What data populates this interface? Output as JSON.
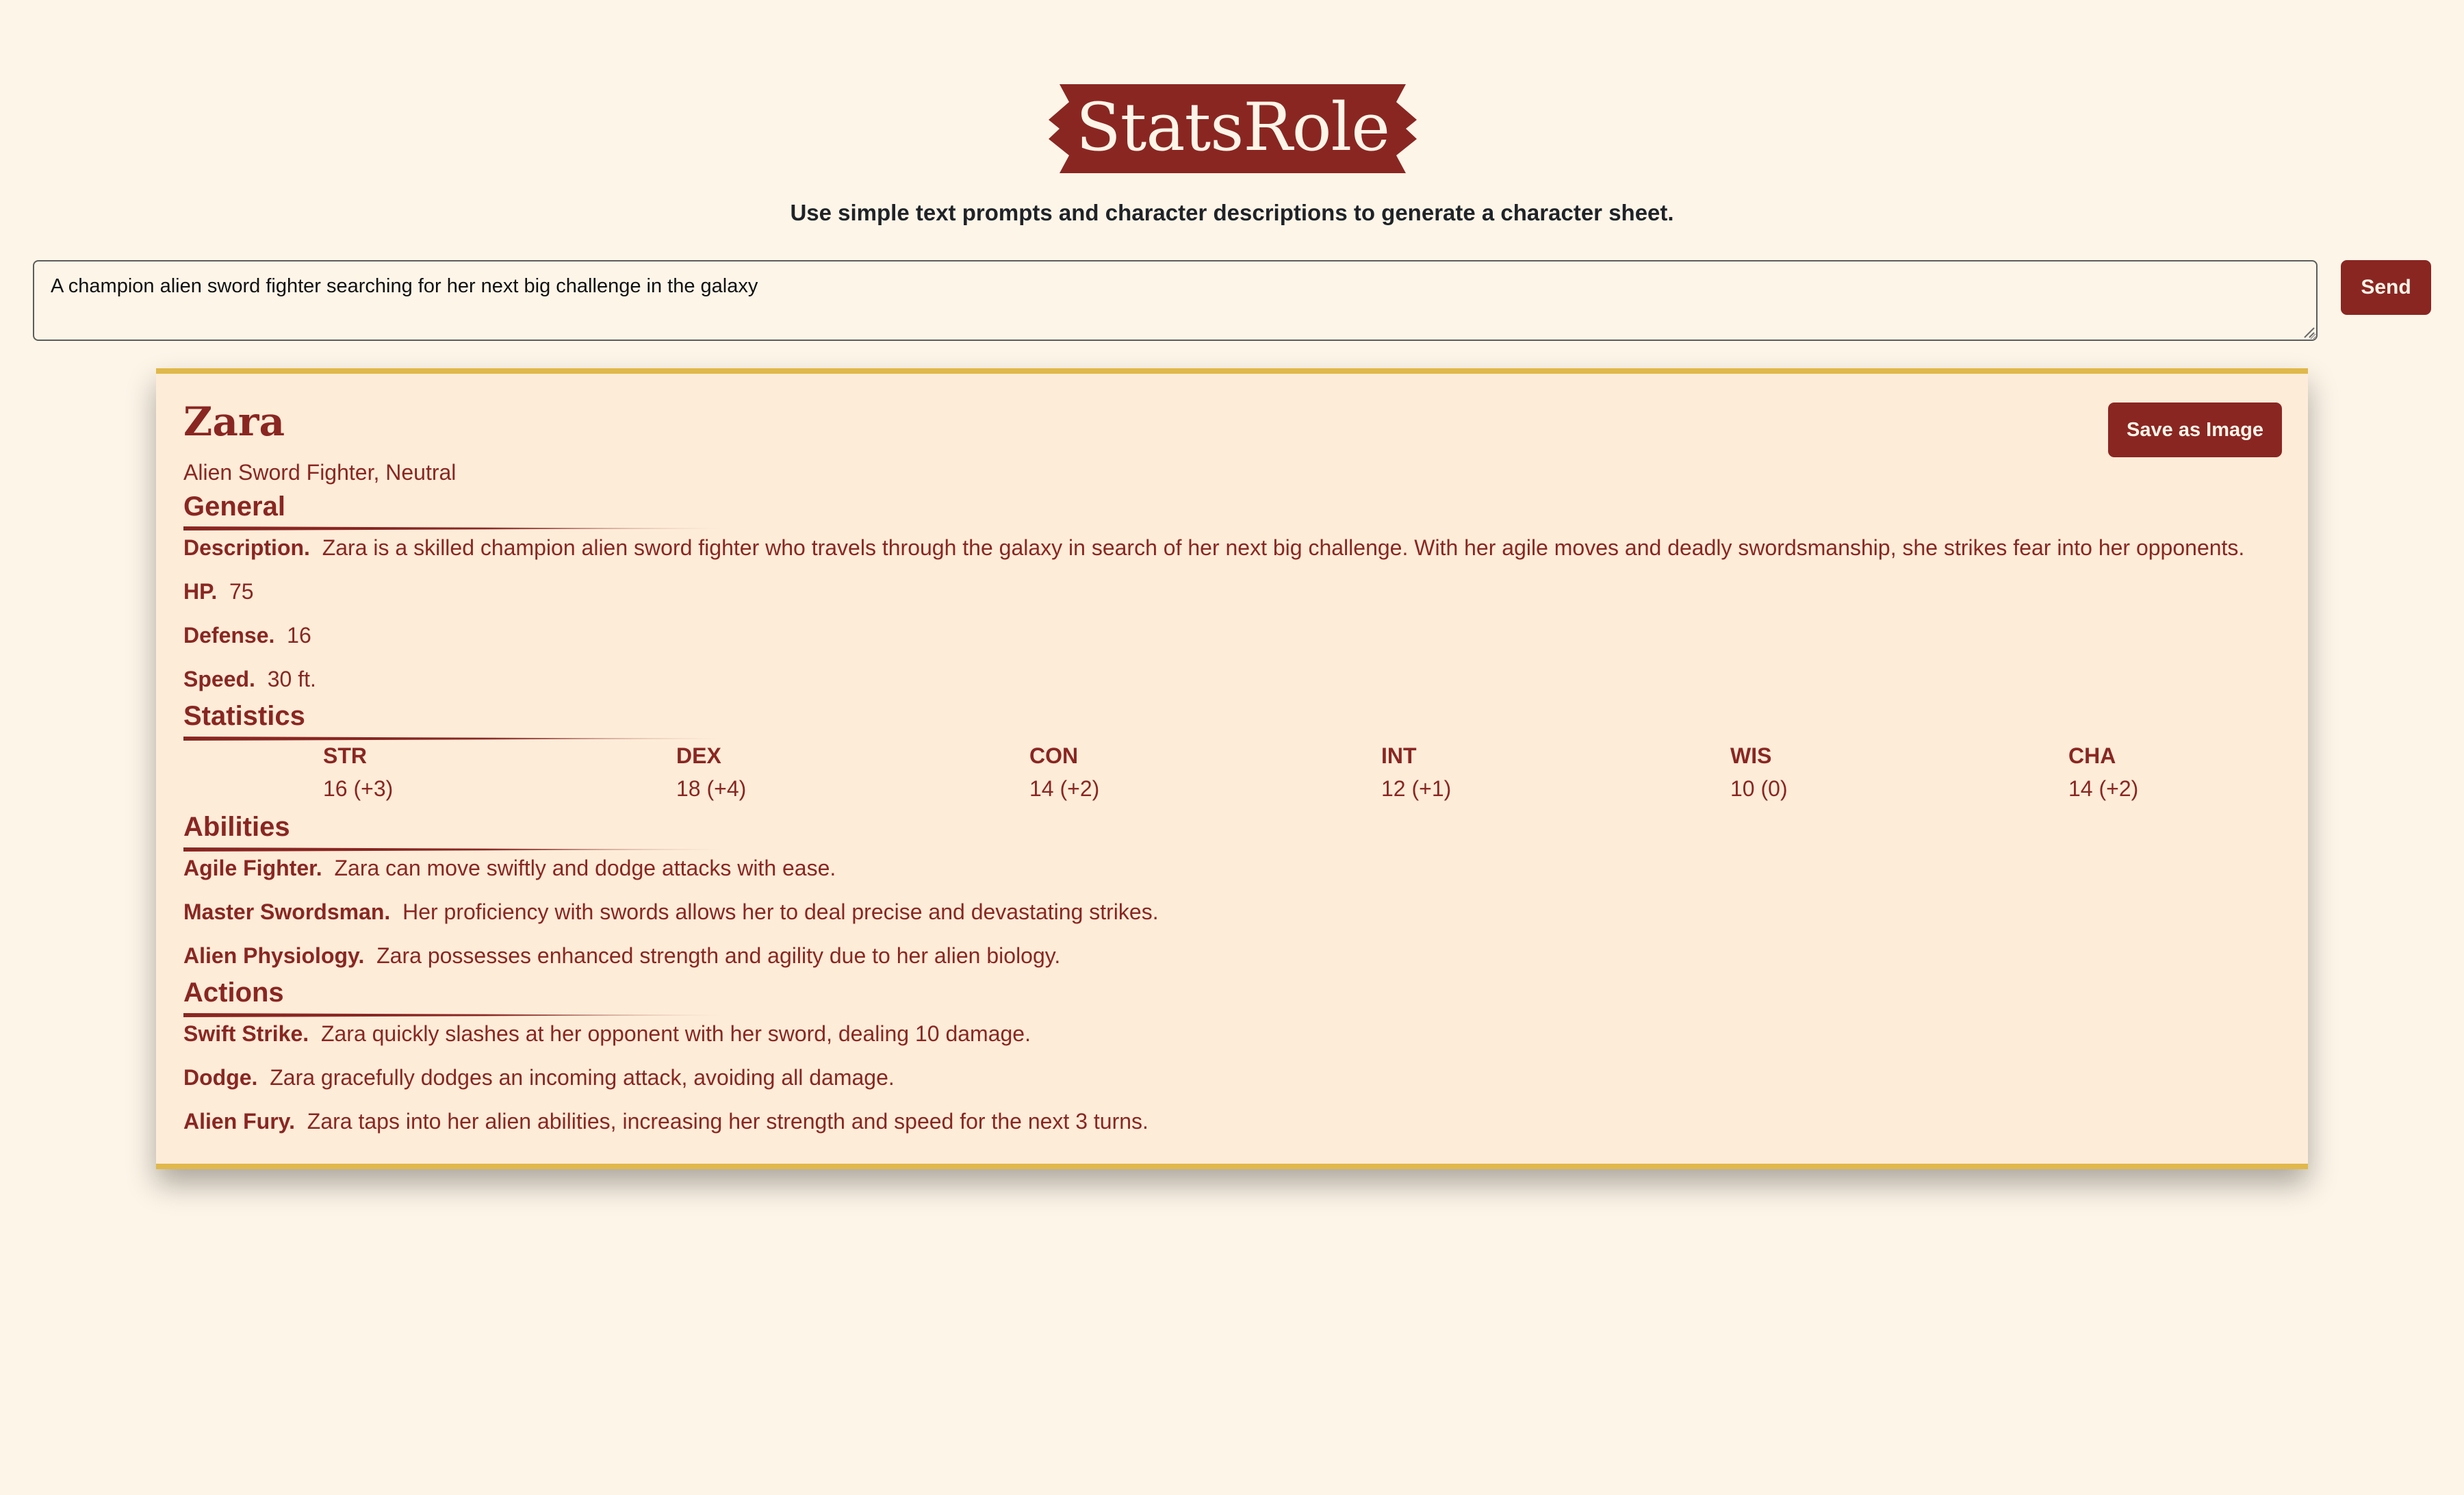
{
  "header": {
    "logo_text": "StatsRole",
    "tagline": "Use simple text prompts and character descriptions to generate a character sheet."
  },
  "prompt": {
    "value": "A champion alien sword fighter searching for her next big challenge in the galaxy",
    "send_label": "Send"
  },
  "sheet": {
    "name": "Zara",
    "subtitle": "Alien Sword Fighter, Neutral",
    "save_label": "Save as Image",
    "general": {
      "title": "General",
      "description_label": "Description.",
      "description": "Zara is a skilled champion alien sword fighter who travels through the galaxy in search of her next big challenge. With her agile moves and deadly swordsmanship, she strikes fear into her opponents.",
      "hp_label": "HP.",
      "hp": "75",
      "defense_label": "Defense.",
      "defense": "16",
      "speed_label": "Speed.",
      "speed": "30 ft."
    },
    "statistics": {
      "title": "Statistics",
      "stats": [
        {
          "name": "STR",
          "value": "16 (+3)"
        },
        {
          "name": "DEX",
          "value": "18 (+4)"
        },
        {
          "name": "CON",
          "value": "14 (+2)"
        },
        {
          "name": "INT",
          "value": "12 (+1)"
        },
        {
          "name": "WIS",
          "value": "10 (0)"
        },
        {
          "name": "CHA",
          "value": "14 (+2)"
        }
      ]
    },
    "abilities": {
      "title": "Abilities",
      "items": [
        {
          "name": "Agile Fighter.",
          "text": "Zara can move swiftly and dodge attacks with ease."
        },
        {
          "name": "Master Swordsman.",
          "text": "Her proficiency with swords allows her to deal precise and devastating strikes."
        },
        {
          "name": "Alien Physiology.",
          "text": "Zara possesses enhanced strength and agility due to her alien biology."
        }
      ]
    },
    "actions": {
      "title": "Actions",
      "items": [
        {
          "name": "Swift Strike.",
          "text": "Zara quickly slashes at her opponent with her sword, dealing 10 damage."
        },
        {
          "name": "Dodge.",
          "text": "Zara gracefully dodges an incoming attack, avoiding all damage."
        },
        {
          "name": "Alien Fury.",
          "text": "Zara taps into her alien abilities, increasing her strength and speed for the next 3 turns."
        }
      ]
    }
  },
  "colors": {
    "background": "#fdf5e8",
    "card_background": "#fdecd8",
    "accent": "#8a2622",
    "card_border": "#e0b84a"
  }
}
